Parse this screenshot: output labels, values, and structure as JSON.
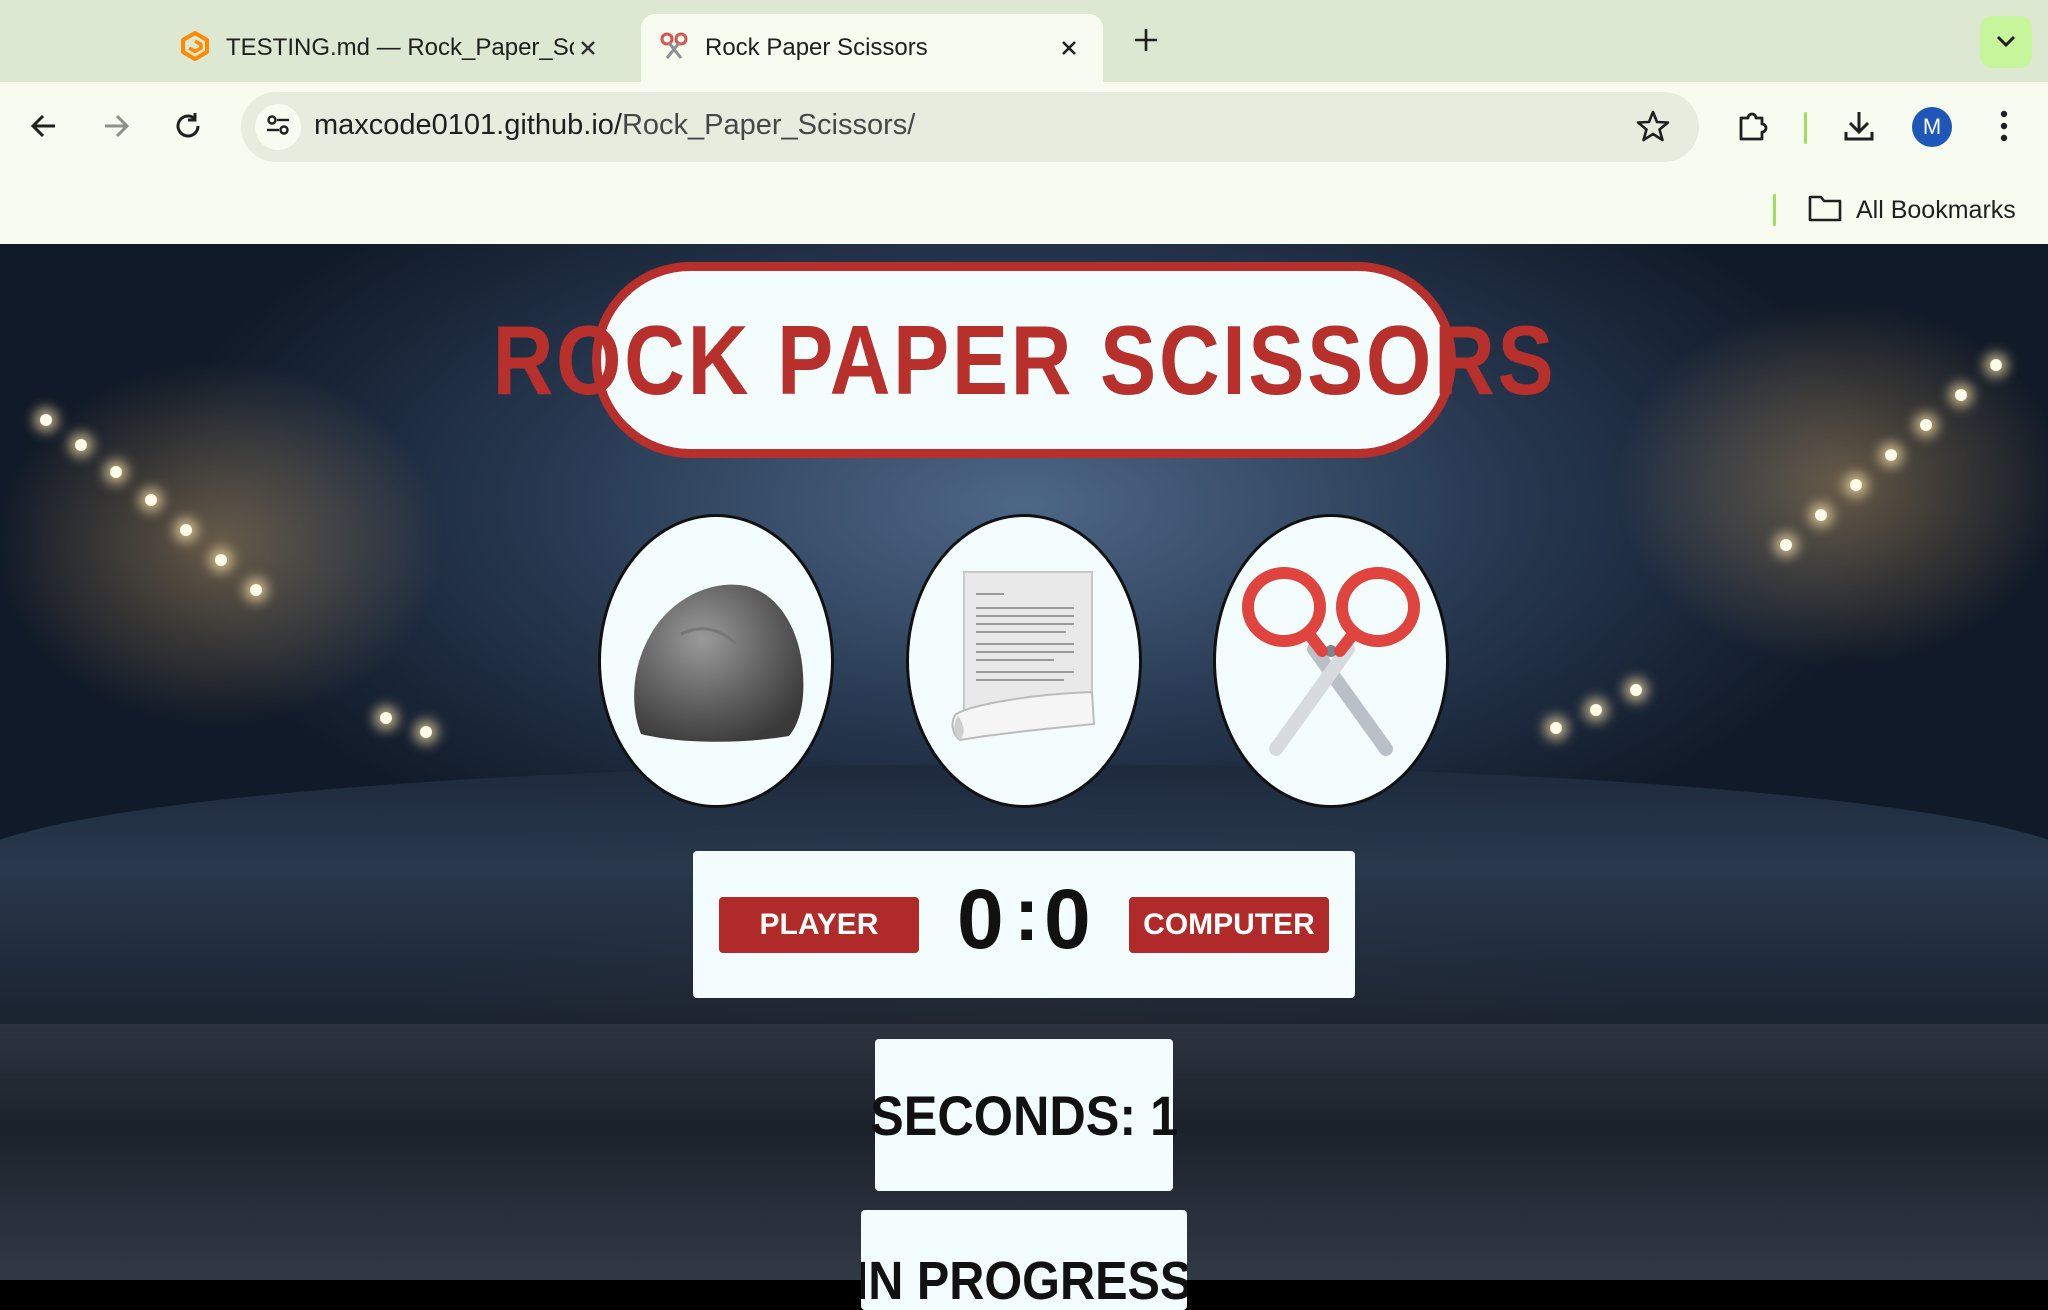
{
  "browser": {
    "tabs": [
      {
        "title": "TESTING.md — Rock_Paper_Scissors",
        "icon": "gitpod-icon",
        "active": false
      },
      {
        "title": "Rock Paper Scissors",
        "icon": "scissors-icon",
        "active": true
      }
    ],
    "url": {
      "host": "maxcode0101.github.io/",
      "path": "Rock_Paper_Scissors/"
    },
    "profile_initial": "M",
    "bookmarks": {
      "all_label": "All Bookmarks"
    }
  },
  "game": {
    "title": "ROCK PAPER SCISSORS",
    "choices": [
      {
        "name": "rock",
        "icon": "rock-image"
      },
      {
        "name": "paper",
        "icon": "paper-image"
      },
      {
        "name": "scissors",
        "icon": "scissors-image"
      }
    ],
    "score": {
      "player_label": "PLAYER",
      "computer_label": "COMPUTER",
      "player": "0",
      "separator": ":",
      "computer": "0"
    },
    "timer_text": "SECONDS: 1",
    "status_text": "IN PROGRESS"
  },
  "colors": {
    "accent_red": "#b8302c",
    "panel_bg": "#f3fdfd",
    "tabstrip_bg": "#dce8d2",
    "toolbar_bg": "#f8fbef"
  }
}
